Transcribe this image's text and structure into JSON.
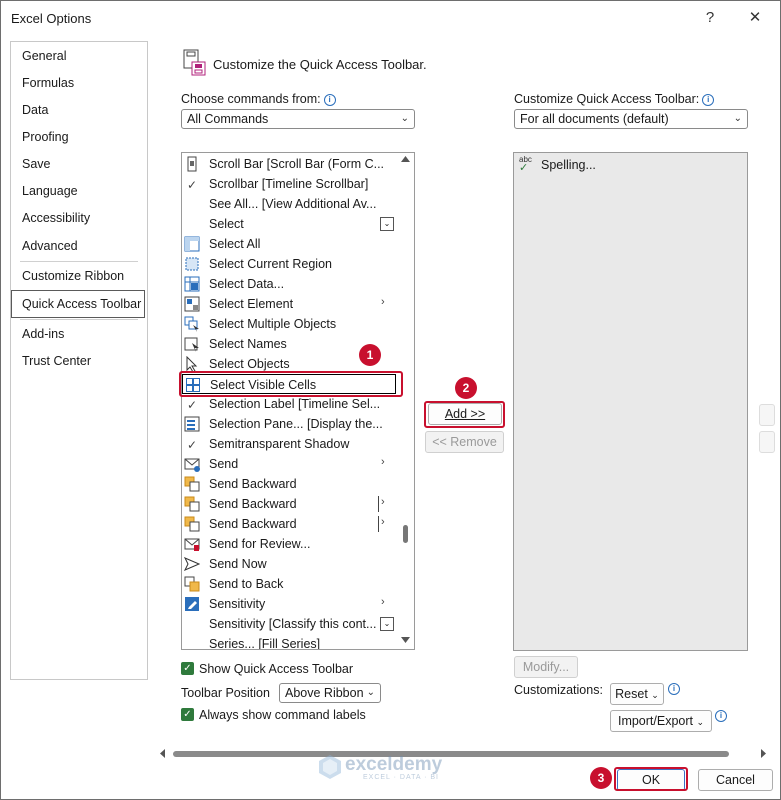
{
  "window": {
    "title": "Excel Options",
    "help_label": "?",
    "close_label": "✕"
  },
  "nav": {
    "items": [
      {
        "label": "General"
      },
      {
        "label": "Formulas"
      },
      {
        "label": "Data"
      },
      {
        "label": "Proofing"
      },
      {
        "label": "Save"
      },
      {
        "label": "Language"
      },
      {
        "label": "Accessibility"
      },
      {
        "label": "Advanced"
      },
      {
        "label": "Customize Ribbon"
      },
      {
        "label": "Quick Access Toolbar"
      },
      {
        "label": "Add-ins"
      },
      {
        "label": "Trust Center"
      }
    ],
    "selected": "Quick Access Toolbar"
  },
  "header": {
    "text": "Customize the Quick Access Toolbar."
  },
  "left": {
    "choose_label": "Choose commands from:",
    "choose_value": "All Commands",
    "commands": [
      {
        "label": "Scroll Bar [Scroll Bar (Form C...",
        "icon": "scrollbar-form-icon"
      },
      {
        "label": "Scrollbar [Timeline Scrollbar]",
        "icon": "check-icon"
      },
      {
        "label": "See All... [View Additional Av...",
        "icon": "none"
      },
      {
        "label": "Select",
        "icon": "none",
        "extra": "dropdown"
      },
      {
        "label": "Select All",
        "icon": "select-all-icon"
      },
      {
        "label": "Select Current Region",
        "icon": "select-region-icon"
      },
      {
        "label": "Select Data...",
        "icon": "select-data-icon"
      },
      {
        "label": "Select Element",
        "icon": "select-element-icon",
        "extra": "submenu"
      },
      {
        "label": "Select Multiple Objects",
        "icon": "select-multiple-icon"
      },
      {
        "label": "Select Names",
        "icon": "select-names-icon"
      },
      {
        "label": "Select Objects",
        "icon": "pointer-icon"
      },
      {
        "label": "Select Visible Cells",
        "icon": "visible-cells-icon",
        "highlight": true
      },
      {
        "label": "Selection Label [Timeline Sel...",
        "icon": "check-icon"
      },
      {
        "label": "Selection Pane... [Display the...",
        "icon": "selection-pane-icon"
      },
      {
        "label": "Semitransparent Shadow",
        "icon": "check-icon"
      },
      {
        "label": "Send",
        "icon": "send-mail-icon",
        "extra": "submenu"
      },
      {
        "label": "Send Backward",
        "icon": "send-backward-icon"
      },
      {
        "label": "Send Backward",
        "icon": "send-backward-icon",
        "extra": "split"
      },
      {
        "label": "Send Backward",
        "icon": "send-backward-icon",
        "extra": "split"
      },
      {
        "label": "Send for Review...",
        "icon": "send-review-icon"
      },
      {
        "label": "Send Now",
        "icon": "send-now-icon"
      },
      {
        "label": "Send to Back",
        "icon": "send-back-icon"
      },
      {
        "label": "Sensitivity",
        "icon": "sensitivity-icon",
        "extra": "submenu"
      },
      {
        "label": "Sensitivity [Classify this cont...",
        "icon": "none",
        "extra": "dropdown"
      },
      {
        "label": "Series... [Fill Series]",
        "icon": "none"
      }
    ],
    "show_qat_label": "Show Quick Access Toolbar",
    "toolbar_position_label": "Toolbar Position",
    "toolbar_position_value": "Above Ribbon",
    "always_show_label": "Always show command labels"
  },
  "middle": {
    "add_label": "Add >>",
    "remove_label": "<< Remove"
  },
  "right": {
    "customize_label": "Customize Quick Access Toolbar:",
    "customize_value": "For all documents (default)",
    "items": [
      {
        "label": "Spelling...",
        "icon": "spelling-icon",
        "icon_text": "abc"
      }
    ],
    "modify_label": "Modify...",
    "customizations_label": "Customizations:",
    "reset_label": "Reset",
    "import_export_label": "Import/Export"
  },
  "footer": {
    "ok_label": "OK",
    "cancel_label": "Cancel"
  },
  "annotations": [
    {
      "label": "1"
    },
    {
      "label": "2"
    },
    {
      "label": "3"
    }
  ],
  "watermark": {
    "name": "exceldemy",
    "tagline": "EXCEL · DATA · BI"
  },
  "colors": {
    "annotation_red": "#c8102e",
    "checkbox_green": "#2f7a3c",
    "link_blue": "#2a6ebb"
  }
}
